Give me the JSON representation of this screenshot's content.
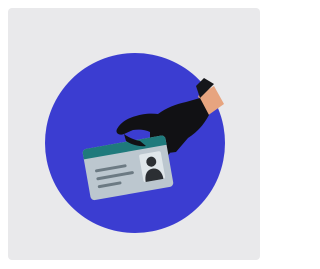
{
  "illustration": {
    "name": "identity-theft-illustration",
    "icons": [
      "gloved-hand-icon",
      "id-card-icon",
      "person-silhouette-icon"
    ],
    "colors": {
      "tile_background": "#e9e9eb",
      "circle": "#3b3dd1",
      "glove": "#111114",
      "skin": "#e7a47f",
      "cuff": "#15161a",
      "card_body": "#bcc7cf",
      "card_header": "#1f7a7c",
      "photo_frame": "#dfe6ea",
      "silhouette": "#2b2f33",
      "text_lines": "#6c7a83"
    }
  }
}
